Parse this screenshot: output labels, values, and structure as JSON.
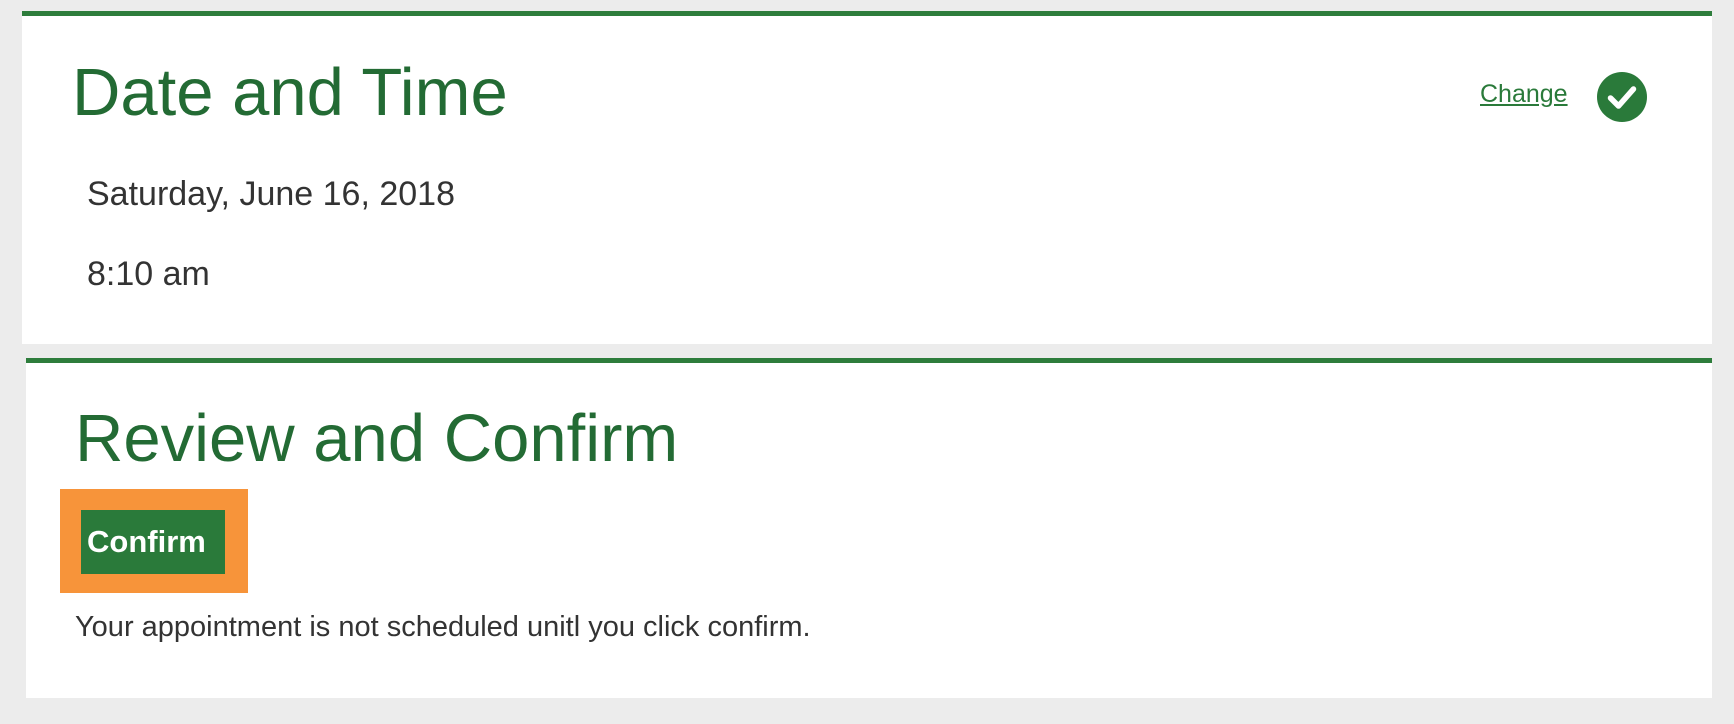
{
  "date_time_section": {
    "title": "Date and Time",
    "change_label": "Change",
    "status_icon": "checkmark-circle-icon",
    "date": "Saturday, June 16, 2018",
    "time": "8:10 am"
  },
  "review_section": {
    "title": "Review and Confirm",
    "confirm_label": "Confirm",
    "notice": "Your appointment is not scheduled unitl you click confirm."
  },
  "colors": {
    "accent_green": "#2a7a3a",
    "heading_green": "#236b34",
    "highlight_orange": "#f7943a",
    "background": "#ececec"
  }
}
